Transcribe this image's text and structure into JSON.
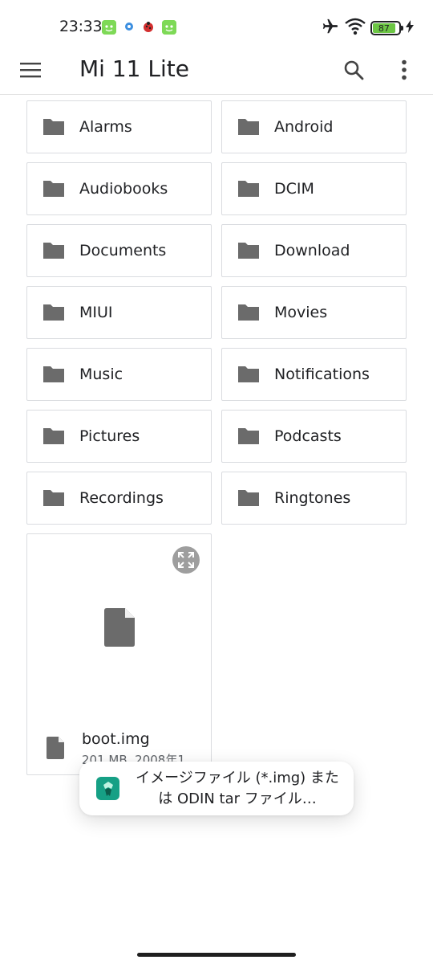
{
  "status_bar": {
    "time": "23:33",
    "battery_level": "87",
    "icons": [
      "notification-app-icon",
      "settings-notification-icon",
      "ladybug-notification-icon",
      "notification-app-icon",
      "airplane-mode-icon",
      "wifi-icon",
      "battery-icon",
      "charging-icon"
    ]
  },
  "app_bar": {
    "title": "Mi 11 Lite",
    "icons": [
      "menu-icon",
      "search-icon",
      "more-vert-icon"
    ]
  },
  "folders": [
    {
      "label": "Alarms"
    },
    {
      "label": "Android"
    },
    {
      "label": "Audiobooks"
    },
    {
      "label": "DCIM"
    },
    {
      "label": "Documents"
    },
    {
      "label": "Download"
    },
    {
      "label": "MIUI"
    },
    {
      "label": "Movies"
    },
    {
      "label": "Music"
    },
    {
      "label": "Notifications"
    },
    {
      "label": "Pictures"
    },
    {
      "label": "Podcasts"
    },
    {
      "label": "Recordings"
    },
    {
      "label": "Ringtones"
    }
  ],
  "file": {
    "name": "boot.img",
    "meta": "201 MB, 2008年1"
  },
  "toast": {
    "text": "イメージファイル (*.img) または ODIN tar ファイル…"
  },
  "colors": {
    "folder_icon": "#6b6b6b",
    "border": "#dadce0",
    "toast_app_icon": "#16a085",
    "battery_fill": "#6cc644"
  }
}
